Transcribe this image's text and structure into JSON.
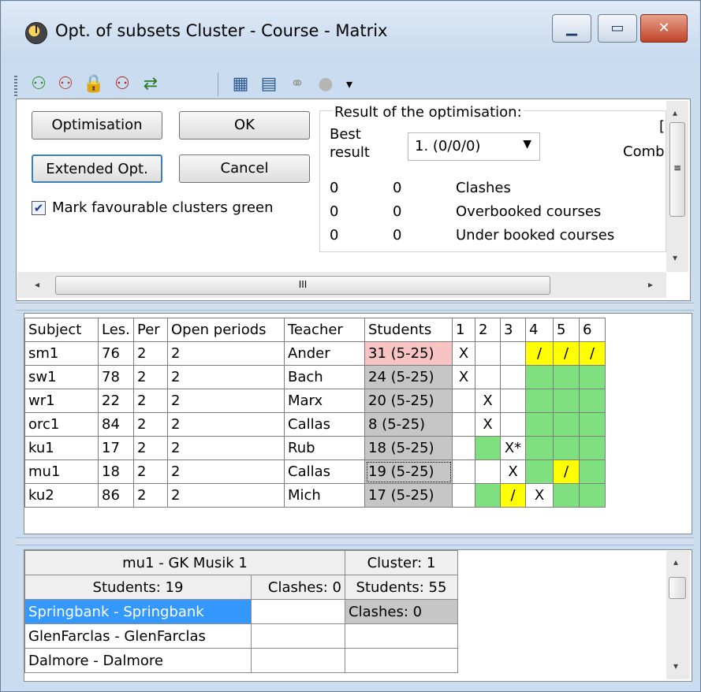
{
  "window": {
    "title": "Opt. of subsets Cluster - Course - Matrix",
    "min_glyph": "▁",
    "max_glyph": "▭",
    "close_glyph": "✕"
  },
  "toolbar": {
    "icons": [
      "students-green-icon",
      "students-red-icon",
      "lock-icon",
      "students-clash-icon",
      "swap-icon",
      "calculator-icon",
      "form-star-icon",
      "chain-icon",
      "circle-icon",
      "dropdown-icon"
    ],
    "glyphs": [
      "⚇",
      "⚇",
      "🔒",
      "⚇",
      "⇄",
      "▦",
      "▤",
      "⚭",
      "●",
      "▾"
    ]
  },
  "controls": {
    "optimisation": "Optimisation",
    "ok": "OK",
    "extended_opt": "Extended Opt.",
    "cancel": "Cancel",
    "mark_green": "Mark favourable clusters green",
    "mark_green_checked": "✔"
  },
  "result": {
    "group_title": "Result of the optimisation:",
    "best_result_line1": "Best",
    "best_result_line2": "result",
    "selected": "1.  (0/0/0)",
    "combi_label": "Combi",
    "bracket": "[",
    "rows": [
      {
        "a": "0",
        "b": "0",
        "label": "Clashes"
      },
      {
        "a": "0",
        "b": "0",
        "label": "Overbooked courses"
      },
      {
        "a": "0",
        "b": "0",
        "label": "Under booked courses"
      }
    ]
  },
  "scroll": {
    "thumb_grip": "III",
    "left": "◂",
    "right": "▸",
    "up": "▴",
    "down": "▾",
    "vgrip": "≡"
  },
  "grid": {
    "headers": [
      "Subject",
      "Les.",
      "Per",
      "Open periods",
      "Teacher",
      "Students",
      "1",
      "2",
      "3",
      "4",
      "5",
      "6"
    ],
    "rows": [
      {
        "subject": "sm1",
        "les": "76",
        "per": "2",
        "open": "2",
        "teacher": "Ander",
        "students": "31 (5-25)",
        "c": [
          "X",
          "",
          "",
          "/",
          "/",
          "/"
        ]
      },
      {
        "subject": "sw1",
        "les": "78",
        "per": "2",
        "open": "2",
        "teacher": "Bach",
        "students": "24 (5-25)",
        "c": [
          "X",
          "",
          "",
          "",
          "",
          ""
        ]
      },
      {
        "subject": "wr1",
        "les": "22",
        "per": "2",
        "open": "2",
        "teacher": "Marx",
        "students": "20 (5-25)",
        "c": [
          "",
          "X",
          "",
          "",
          "",
          ""
        ]
      },
      {
        "subject": "orc1",
        "les": "84",
        "per": "2",
        "open": "2",
        "teacher": "Callas",
        "students": "8 (5-25)",
        "c": [
          "",
          "X",
          "",
          "",
          "",
          ""
        ]
      },
      {
        "subject": "ku1",
        "les": "17",
        "per": "2",
        "open": "2",
        "teacher": "Rub",
        "students": "18 (5-25)",
        "c": [
          "",
          "",
          "X*",
          "",
          "",
          ""
        ]
      },
      {
        "subject": "mu1",
        "les": "18",
        "per": "2",
        "open": "2",
        "teacher": "Callas",
        "students": "19 (5-25)",
        "c": [
          "",
          "",
          "X",
          "",
          "/",
          ""
        ]
      },
      {
        "subject": "ku2",
        "les": "86",
        "per": "2",
        "open": "2",
        "teacher": "Mich",
        "students": "17 (5-25)",
        "c": [
          "",
          "",
          "/",
          "X",
          "",
          ""
        ]
      }
    ]
  },
  "bottom": {
    "course_title": "mu1 - GK Musik 1",
    "cluster": "Cluster: 1",
    "students": "Students: 19",
    "clashes": "Clashes: 0",
    "cluster_students": "Students: 55",
    "cluster_clashes": "Clashes: 0",
    "list": [
      "Springbank - Springbank",
      "GlenFarclas - GlenFarclas",
      "Dalmore - Dalmore"
    ]
  }
}
